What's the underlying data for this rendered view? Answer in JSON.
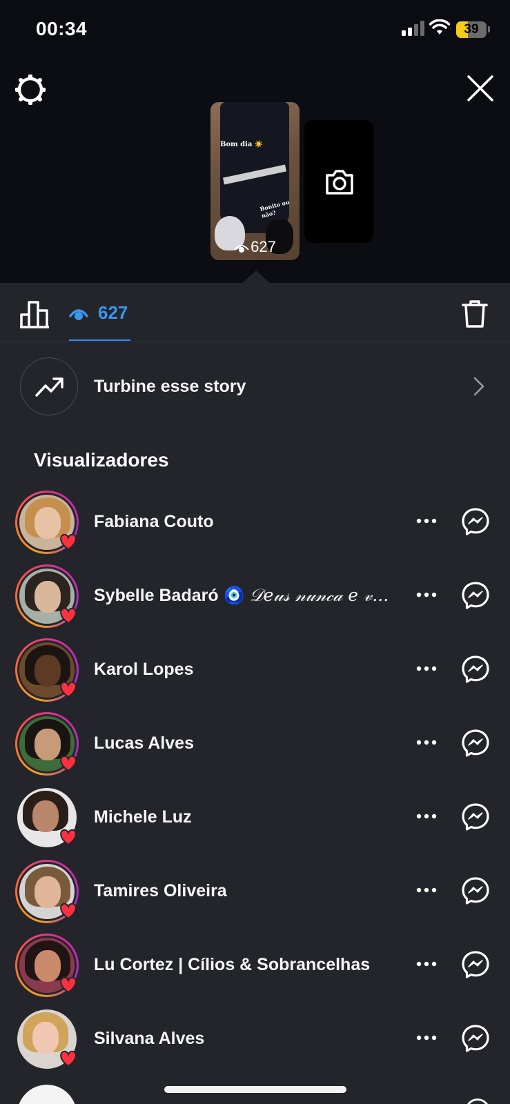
{
  "status_bar": {
    "time": "00:34",
    "battery": "39",
    "battery_level": 0.39
  },
  "story_preview": {
    "caption_top": "Bom dia ☀️",
    "caption_bottom": "Bonito ou não?",
    "view_count": "627"
  },
  "tabs": {
    "viewers_count": "627"
  },
  "boost": {
    "label": "Turbine esse story"
  },
  "section_title": "Visualizadores",
  "viewers": [
    {
      "name": "Fabiana Couto",
      "extra": "",
      "ring": true
    },
    {
      "name": "Sybelle Badaró 🧿",
      "extra": "𝒟𝑒𝓊𝓈 𝓃𝓊𝓃𝒸𝒶 𝑒 𝓋...",
      "ring": true
    },
    {
      "name": "Karol Lopes",
      "extra": "",
      "ring": true
    },
    {
      "name": "Lucas Alves",
      "extra": "",
      "ring": true
    },
    {
      "name": "Michele Luz",
      "extra": "",
      "ring": false
    },
    {
      "name": "Tamires Oliveira",
      "extra": "",
      "ring": true
    },
    {
      "name": "Lu Cortez | Cílios & Sobrancelhas",
      "extra": "",
      "ring": true
    },
    {
      "name": "Silvana Alves",
      "extra": "",
      "ring": false
    }
  ],
  "colors": {
    "accent": "#3897f0",
    "background": "#24252b",
    "top_background": "#0b0d12",
    "heart": "#ff3040"
  },
  "icons": [
    "settings-icon",
    "close-icon",
    "camera-icon",
    "bar-chart-icon",
    "eye-icon",
    "trash-icon",
    "trending-up-icon",
    "chevron-right-icon",
    "more-icon",
    "messenger-icon",
    "heart-icon"
  ]
}
